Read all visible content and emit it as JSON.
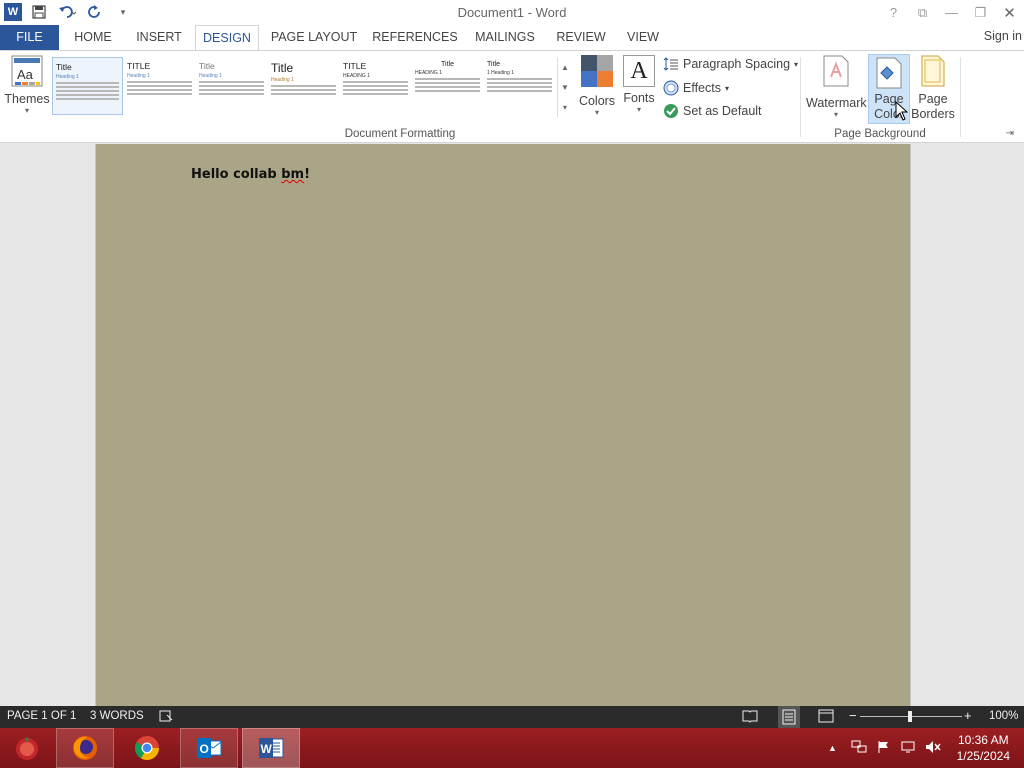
{
  "app": {
    "title": "Document1 - Word",
    "logo_letter": "W"
  },
  "quick_access": {
    "icons": [
      "save-icon",
      "undo-icon",
      "redo-icon",
      "customize-icon"
    ]
  },
  "window_controls": {
    "help": "?",
    "ribbon_options": "⧉",
    "minimize": "—",
    "restore": "❐",
    "close": "✕"
  },
  "tabs": [
    {
      "label": "FILE"
    },
    {
      "label": "HOME"
    },
    {
      "label": "INSERT"
    },
    {
      "label": "DESIGN"
    },
    {
      "label": "PAGE LAYOUT"
    },
    {
      "label": "REFERENCES"
    },
    {
      "label": "MAILINGS"
    },
    {
      "label": "REVIEW"
    },
    {
      "label": "VIEW"
    }
  ],
  "sign_in": "Sign in",
  "ribbon": {
    "themes_label": "Themes",
    "gallery": [
      {
        "title": "Title",
        "heading": "Heading 1"
      },
      {
        "title": "TITLE",
        "heading": "Heading 1"
      },
      {
        "title": "Title",
        "heading": "Heading 1"
      },
      {
        "title": "Title",
        "heading": "Heading 1"
      },
      {
        "title": "TITLE",
        "heading": "HEADING 1"
      },
      {
        "title": "Title",
        "heading": "HEADING 1"
      },
      {
        "title": "Title",
        "heading": "1  Heading 1"
      }
    ],
    "colors_label": "Colors",
    "fonts_label": "Fonts",
    "fonts_glyph": "A",
    "paragraph_spacing": "Paragraph Spacing",
    "effects": "Effects",
    "set_default": "Set as Default",
    "document_formatting": "Document Formatting",
    "watermark": "Watermark",
    "page_color_line1": "Page",
    "page_color_line2": "Color",
    "page_borders_line1": "Page",
    "page_borders_line2": "Borders",
    "page_background": "Page Background"
  },
  "document": {
    "text_plain": "Hello collab ",
    "text_misspelled": "bm",
    "text_end": "!",
    "page_color": "#aaa586"
  },
  "status": {
    "page": "PAGE 1 OF 1",
    "words": "3 WORDS",
    "zoom": "100%",
    "zoom_minus": "−",
    "zoom_plus": "+"
  },
  "taskbar": {
    "apps": [
      "start-icon",
      "firefox-icon",
      "chrome-icon",
      "outlook-icon",
      "word-icon"
    ],
    "time": "10:36 AM",
    "date": "1/25/2024"
  },
  "colors": {
    "accent": "#2b579a",
    "taskbar": "#9c1f22",
    "statusbar": "#2b2b2b"
  }
}
